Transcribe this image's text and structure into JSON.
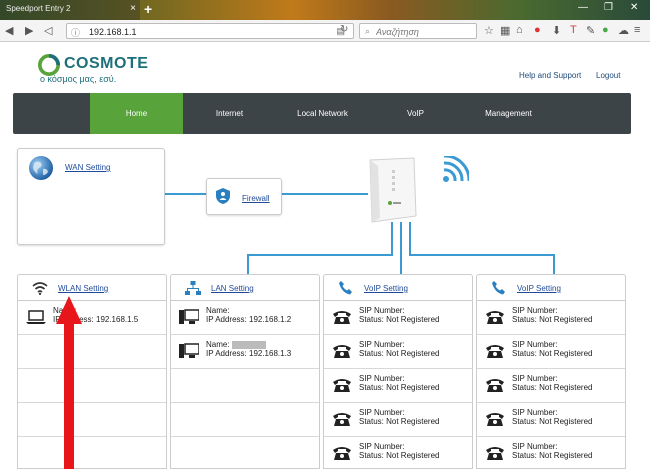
{
  "browser": {
    "tab_title": "Speedport Entry 2",
    "url": "192.168.1.1",
    "search_placeholder": "Αναζήτηση"
  },
  "brand": {
    "name": "COSMOTE",
    "slogan": "ο κόσμος μας, εσύ.",
    "colors": {
      "green": "#58a33a",
      "teal": "#1d6f7a",
      "menu_bg": "#3d4448",
      "link": "#1f4a9a",
      "line": "#3b9ad2"
    }
  },
  "header_links": {
    "help": "Help and Support",
    "logout": "Logout"
  },
  "menu": [
    {
      "label": "Home",
      "active": true
    },
    {
      "label": "Internet",
      "active": false
    },
    {
      "label": "Local Network",
      "active": false
    },
    {
      "label": "VoIP",
      "active": false
    },
    {
      "label": "Management",
      "active": false
    }
  ],
  "wan": {
    "label": "WAN Setting",
    "icon": "globe-icon"
  },
  "firewall": {
    "label": "Firewall",
    "icon": "shield-icon"
  },
  "columns": [
    {
      "title": "WLAN Setting",
      "icon": "wifi-icon",
      "rows": [
        {
          "l1": "Name:",
          "l2": "IP Address: 192.168.1.5",
          "icon": "laptop-icon"
        }
      ]
    },
    {
      "title": "LAN Setting",
      "icon": "network-icon",
      "rows": [
        {
          "l1": "Name:",
          "l2": "IP Address: 192.168.1.2",
          "icon": "desktop-icon"
        },
        {
          "l1": "Name:",
          "l2": "IP Address: 192.168.1.3",
          "icon": "desktop-icon"
        }
      ]
    },
    {
      "title": "VoIP Setting",
      "icon": "phone-icon",
      "rows": [
        {
          "l1": "SIP Number:",
          "l2": "Status: Not Registered",
          "icon": "telephone-icon"
        },
        {
          "l1": "SIP Number:",
          "l2": "Status: Not Registered",
          "icon": "telephone-icon"
        },
        {
          "l1": "SIP Number:",
          "l2": "Status: Not Registered",
          "icon": "telephone-icon"
        },
        {
          "l1": "SIP Number:",
          "l2": "Status: Not Registered",
          "icon": "telephone-icon"
        },
        {
          "l1": "SIP Number:",
          "l2": "Status: Not Registered",
          "icon": "telephone-icon"
        }
      ]
    },
    {
      "title": "VoIP Setting",
      "icon": "phone-icon",
      "rows": [
        {
          "l1": "SIP Number:",
          "l2": "Status: Not Registered",
          "icon": "telephone-icon"
        },
        {
          "l1": "SIP Number:",
          "l2": "Status: Not Registered",
          "icon": "telephone-icon"
        },
        {
          "l1": "SIP Number:",
          "l2": "Status: Not Registered",
          "icon": "telephone-icon"
        },
        {
          "l1": "SIP Number:",
          "l2": "Status: Not Registered",
          "icon": "telephone-icon"
        },
        {
          "l1": "SIP Number:",
          "l2": "Status: Not Registered",
          "icon": "telephone-icon"
        }
      ]
    }
  ]
}
